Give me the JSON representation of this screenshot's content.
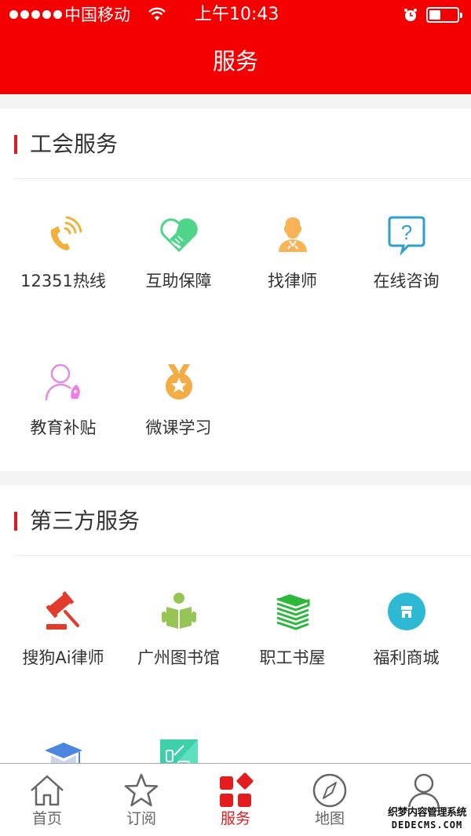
{
  "status_bar": {
    "carrier": "中国移动",
    "time": "上午10:43",
    "signal_bars": 5,
    "battery_level": 0.4
  },
  "header": {
    "title": "服务"
  },
  "sections": [
    {
      "title": "工会服务",
      "items": [
        {
          "label": "12351热线",
          "icon": "phone-icon",
          "color": "#f1b038"
        },
        {
          "label": "互助保障",
          "icon": "handshake-heart-icon",
          "color": "#4fd58a"
        },
        {
          "label": "找律师",
          "icon": "lawyer-icon",
          "color": "#f9b256"
        },
        {
          "label": "在线咨询",
          "icon": "question-bubble-icon",
          "color": "#2e9fd1"
        },
        {
          "label": "教育补贴",
          "icon": "user-rocket-icon",
          "color": "#e58ae6"
        },
        {
          "label": "微课学习",
          "icon": "medal-icon",
          "color": "#f4ad45"
        }
      ]
    },
    {
      "title": "第三方服务",
      "items": [
        {
          "label": "搜狗Ai律师",
          "icon": "gavel-icon",
          "color": "#e23b2b"
        },
        {
          "label": "广州图书馆",
          "icon": "reading-person-icon",
          "color": "#96c556"
        },
        {
          "label": "职工书屋",
          "icon": "book-stack-icon",
          "color": "#2db83b"
        },
        {
          "label": "福利商城",
          "icon": "shop-icon",
          "color": "#2db9d3"
        },
        {
          "label": "",
          "icon": "graduation-cap-icon",
          "color": "#4b86e0"
        },
        {
          "label": "",
          "icon": "charging-station-icon",
          "color": "#3dd1a9"
        }
      ]
    }
  ],
  "tabbar": {
    "active_color": "#e31d1d",
    "tabs": [
      {
        "label": "首页",
        "icon": "home-icon",
        "active": false
      },
      {
        "label": "订阅",
        "icon": "star-icon",
        "active": false
      },
      {
        "label": "服务",
        "icon": "services-grid-icon",
        "active": true
      },
      {
        "label": "地图",
        "icon": "compass-icon",
        "active": false
      },
      {
        "label": "",
        "icon": "user-icon",
        "active": false
      }
    ]
  },
  "watermark": {
    "line1": "织梦内容管理系统",
    "line2": "DEDECMS.COM"
  }
}
